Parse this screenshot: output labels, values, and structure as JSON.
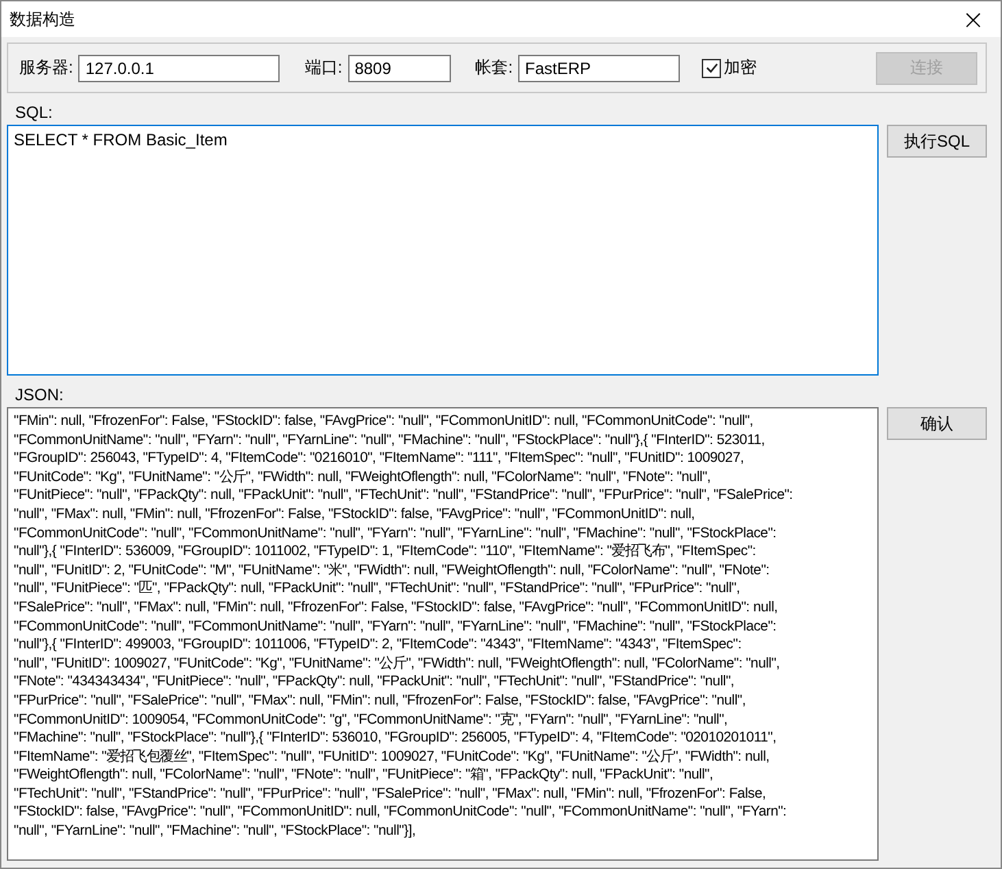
{
  "window": {
    "title": "数据构造",
    "close": "×"
  },
  "connection": {
    "server_label": "服务器:",
    "server": "127.0.0.1",
    "port_label": "端口:",
    "port": "8809",
    "account_label": "帐套:",
    "account": "FastERP",
    "encrypt": {
      "label": "加密",
      "checked": true
    },
    "connect_button": {
      "label": "连接",
      "disabled": true
    }
  },
  "sql": {
    "label": "SQL:",
    "value": "SELECT * FROM Basic_Item",
    "button": "执行SQL"
  },
  "json": {
    "label": "JSON:",
    "button": "确认",
    "lines": [
      "\"FMin\": null, \"FfrozenFor\": False, \"FStockID\": false, \"FAvgPrice\": \"null\", \"FCommonUnitID\": null, \"FCommonUnitCode\": \"null\",",
      "\"FCommonUnitName\": \"null\", \"FYarn\": \"null\", \"FYarnLine\": \"null\", \"FMachine\": \"null\", \"FStockPlace\": \"null\"},{ \"FInterID\": 523011,",
      "\"FGroupID\": 256043, \"FTypeID\": 4, \"FItemCode\": \"0216010\", \"FItemName\": \"111\", \"FItemSpec\": \"null\", \"FUnitID\": 1009027,",
      "\"FUnitCode\": \"Kg\", \"FUnitName\": \"公斤\", \"FWidth\": null, \"FWeightOflength\": null, \"FColorName\": \"null\", \"FNote\": \"null\",",
      "\"FUnitPiece\": \"null\", \"FPackQty\": null, \"FPackUnit\": \"null\", \"FTechUnit\": \"null\", \"FStandPrice\": \"null\", \"FPurPrice\": \"null\", \"FSalePrice\":",
      "\"null\", \"FMax\": null, \"FMin\": null, \"FfrozenFor\": False, \"FStockID\": false, \"FAvgPrice\": \"null\", \"FCommonUnitID\": null,",
      "\"FCommonUnitCode\": \"null\", \"FCommonUnitName\": \"null\", \"FYarn\": \"null\", \"FYarnLine\": \"null\", \"FMachine\": \"null\", \"FStockPlace\":",
      "\"null\"},{ \"FInterID\": 536009, \"FGroupID\": 1011002, \"FTypeID\": 1, \"FItemCode\": \"110\", \"FItemName\": \"爱招飞布\", \"FItemSpec\":",
      "\"null\", \"FUnitID\": 2, \"FUnitCode\": \"M\", \"FUnitName\": \"米\", \"FWidth\": null, \"FWeightOflength\": null, \"FColorName\": \"null\", \"FNote\":",
      "\"null\", \"FUnitPiece\": \"匹\", \"FPackQty\": null, \"FPackUnit\": \"null\", \"FTechUnit\": \"null\", \"FStandPrice\": \"null\", \"FPurPrice\": \"null\",",
      "\"FSalePrice\": \"null\", \"FMax\": null, \"FMin\": null, \"FfrozenFor\": False, \"FStockID\": false, \"FAvgPrice\": \"null\", \"FCommonUnitID\": null,",
      "\"FCommonUnitCode\": \"null\", \"FCommonUnitName\": \"null\", \"FYarn\": \"null\", \"FYarnLine\": \"null\", \"FMachine\": \"null\", \"FStockPlace\":",
      "\"null\"},{ \"FInterID\": 499003, \"FGroupID\": 1011006, \"FTypeID\": 2, \"FItemCode\": \"4343\", \"FItemName\": \"4343\", \"FItemSpec\":",
      "\"null\", \"FUnitID\": 1009027, \"FUnitCode\": \"Kg\", \"FUnitName\": \"公斤\", \"FWidth\": null, \"FWeightOflength\": null, \"FColorName\": \"null\",",
      "\"FNote\": \"434343434\", \"FUnitPiece\": \"null\", \"FPackQty\": null, \"FPackUnit\": \"null\", \"FTechUnit\": \"null\", \"FStandPrice\": \"null\",",
      "\"FPurPrice\": \"null\", \"FSalePrice\": \"null\", \"FMax\": null, \"FMin\": null, \"FfrozenFor\": False, \"FStockID\": false, \"FAvgPrice\": \"null\",",
      "\"FCommonUnitID\": 1009054, \"FCommonUnitCode\": \"g\", \"FCommonUnitName\": \"克\", \"FYarn\": \"null\", \"FYarnLine\": \"null\",",
      "\"FMachine\": \"null\", \"FStockPlace\": \"null\"},{ \"FInterID\": 536010, \"FGroupID\": 256005, \"FTypeID\": 4, \"FItemCode\": \"02010201011\",",
      "\"FItemName\": \"爱招飞包覆丝\", \"FItemSpec\": \"null\", \"FUnitID\": 1009027, \"FUnitCode\": \"Kg\", \"FUnitName\": \"公斤\", \"FWidth\": null,",
      "\"FWeightOflength\": null, \"FColorName\": \"null\", \"FNote\": \"null\", \"FUnitPiece\": \"箱\", \"FPackQty\": null, \"FPackUnit\": \"null\",",
      "\"FTechUnit\": \"null\", \"FStandPrice\": \"null\", \"FPurPrice\": \"null\", \"FSalePrice\": \"null\", \"FMax\": null, \"FMin\": null, \"FfrozenFor\": False,",
      "\"FStockID\": false, \"FAvgPrice\": \"null\", \"FCommonUnitID\": null, \"FCommonUnitCode\": \"null\", \"FCommonUnitName\": \"null\", \"FYarn\":",
      "\"null\", \"FYarnLine\": \"null\", \"FMachine\": \"null\", \"FStockPlace\": \"null\"}],"
    ]
  }
}
